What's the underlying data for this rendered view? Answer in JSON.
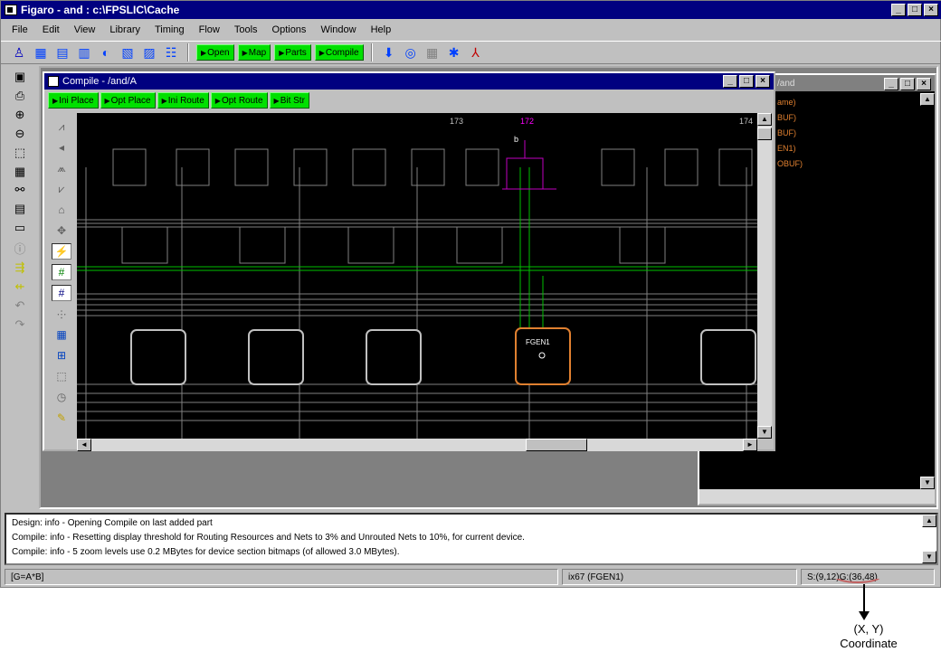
{
  "app": {
    "title": "Figaro - and : c:\\FPSLIC\\Cache"
  },
  "menu": [
    "File",
    "Edit",
    "View",
    "Library",
    "Timing",
    "Flow",
    "Tools",
    "Options",
    "Window",
    "Help"
  ],
  "toolbar": {
    "buttons": [
      "Open",
      "Map",
      "Parts",
      "Compile"
    ]
  },
  "compile_window": {
    "title": "Compile - /and/A",
    "buttons": [
      "Ini Place",
      "Opt Place",
      "Ini Route",
      "Opt Route",
      "Bit Str"
    ],
    "canvas_labels": {
      "col1": "173",
      "col2": "172",
      "col3": "174",
      "pin_b": "b",
      "block": "FGEN1"
    }
  },
  "right_window": {
    "title": "/and",
    "items": [
      "ame)",
      "BUF)",
      "BUF)",
      "EN1)",
      "OBUF)"
    ]
  },
  "messages": [
    "Design: info - Opening Compile on last added part",
    "Compile: info - Resetting display threshold for Routing Resources and Nets to 3% and Unrouted Nets to 10%, for current device.",
    "Compile: info - 5 zoom levels use 0.2 MBytes for device section bitmaps (of allowed 3.0 MBytes)."
  ],
  "statusbar": {
    "expr": "[G=A*B]",
    "instance": "ix67 (FGEN1)",
    "site": "S:(9,12)",
    "grid": "G:(36,48)"
  },
  "annotation": {
    "line1": "(X, Y)",
    "line2": "Coordinate"
  },
  "colors": {
    "title_bg": "#000080",
    "button_green": "#00e000",
    "highlight": "#c000c0",
    "annotation_ring": "#c06060"
  }
}
